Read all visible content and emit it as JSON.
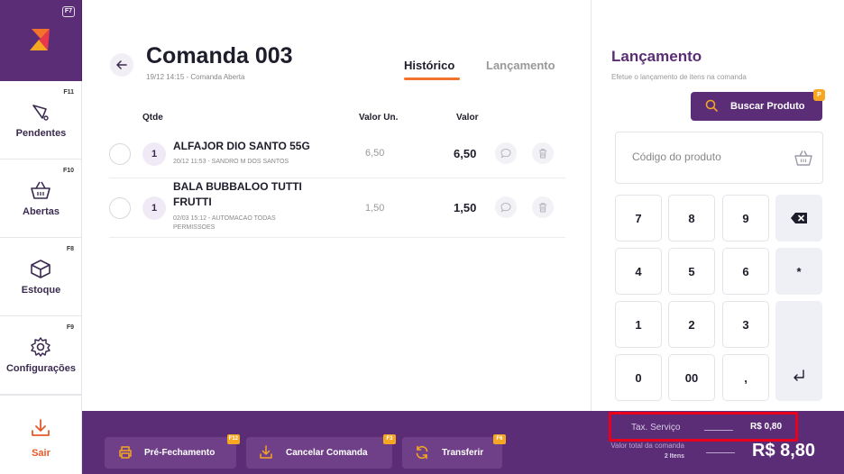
{
  "sidebar": {
    "logo_badge": "F7",
    "items": [
      {
        "label": "Pendentes",
        "badge": "F11",
        "icon": "bell-icon"
      },
      {
        "label": "Abertas",
        "badge": "F10",
        "icon": "basket-icon"
      },
      {
        "label": "Estoque",
        "badge": "F8",
        "icon": "box-icon"
      },
      {
        "label": "Configurações",
        "badge": "F9",
        "icon": "gear-icon"
      },
      {
        "label": "Sair",
        "badge": "",
        "icon": "download-icon"
      }
    ]
  },
  "header": {
    "title": "Comanda 003",
    "subtitle": "19/12 14:15 - Comanda Aberta",
    "tabs": [
      {
        "label": "Histórico",
        "active": true
      },
      {
        "label": "Lançamento",
        "active": false
      }
    ]
  },
  "table": {
    "columns": [
      "Qtde",
      "Valor Un.",
      "Valor"
    ],
    "rows": [
      {
        "qty": "1",
        "name": "ALFAJOR DIO SANTO 55G",
        "meta": "20/12 11:53 - SANDRO M DOS SANTOS",
        "unit": "6,50",
        "value": "6,50"
      },
      {
        "qty": "1",
        "name": "BALA BUBBALOO TUTTI FRUTTI",
        "meta": "02/03 15:12 - AUTOMACAO TODAS PERMISSOES",
        "unit": "1,50",
        "value": "1,50"
      }
    ]
  },
  "panel": {
    "title": "Lançamento",
    "subtitle": "Efetue o lançamento de itens na comanda",
    "search_label": "Buscar Produto",
    "search_badge": "P",
    "code_placeholder": "Código do produto",
    "keys": [
      "7",
      "8",
      "9",
      "4",
      "5",
      "6",
      "*",
      "1",
      "2",
      "3",
      "0",
      "00",
      ","
    ]
  },
  "footer": {
    "buttons": [
      {
        "label": "Pré-Fechamento",
        "badge": "F12",
        "icon": "printer-icon"
      },
      {
        "label": "Cancelar Comanda",
        "badge": "F3",
        "icon": "download-icon"
      },
      {
        "label": "Transferir",
        "badge": "F6",
        "icon": "refresh-icon"
      }
    ],
    "tax_label": "Tax. Serviço",
    "tax_value": "R$ 0,80",
    "total_label": "Valor total da comanda",
    "total_items": "2 Itens",
    "total_value": "R$ 8,80"
  },
  "colors": {
    "brand": "#5b2d77",
    "accent": "#f3722c",
    "badge": "#f5a623",
    "highlight": "#e8001c"
  }
}
